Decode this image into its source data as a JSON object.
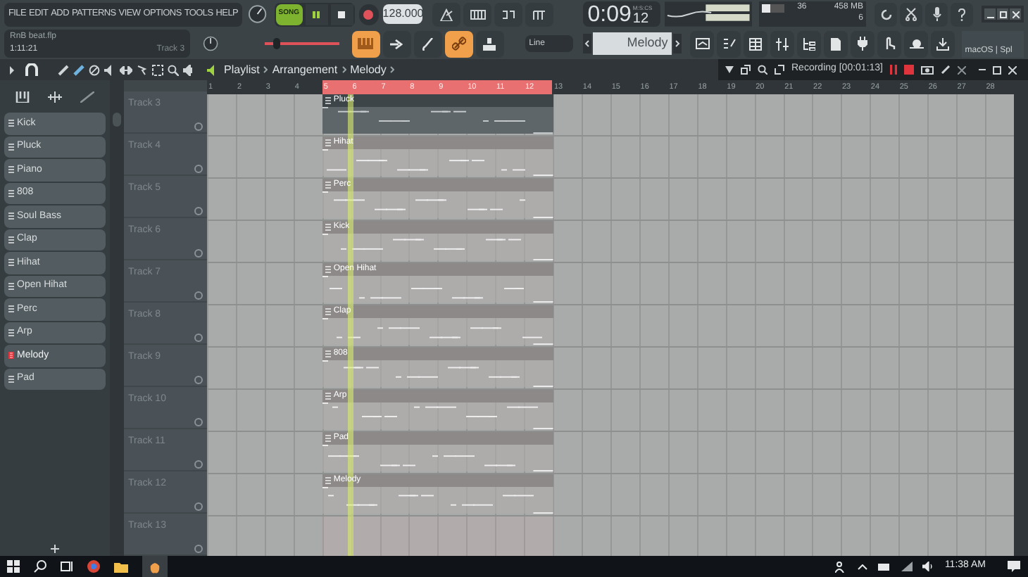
{
  "menu": [
    "FILE",
    "EDIT",
    "ADD",
    "PATTERNS",
    "VIEW",
    "OPTIONS",
    "TOOLS",
    "HELP"
  ],
  "song_info": {
    "file": "RnB beat.flp",
    "position": "1:11:21",
    "hint": "Track 3"
  },
  "transport": {
    "mode": "SONG",
    "song_mode": true,
    "recording": false,
    "tempo": "128.000"
  },
  "time": {
    "display": "0:09",
    "centiseconds": "12",
    "unit": "M:S:CS"
  },
  "cpu": {
    "value": "36",
    "memory": "458 MB",
    "polyphony": "6",
    "level": 0.4
  },
  "snap": "Line",
  "pattern": "Melody",
  "project_label": "macOS | Spl",
  "breadcrumb": [
    "Playlist",
    "Arrangement",
    "Melody"
  ],
  "recording_label": "Recording [00:01:13]",
  "channels": [
    {
      "name": "Kick",
      "selected": false
    },
    {
      "name": "Pluck",
      "selected": false
    },
    {
      "name": "Piano",
      "selected": false
    },
    {
      "name": "808",
      "selected": false
    },
    {
      "name": "Soul Bass",
      "selected": false
    },
    {
      "name": "Clap",
      "selected": false
    },
    {
      "name": "Hihat",
      "selected": false
    },
    {
      "name": "Open Hihat",
      "selected": false
    },
    {
      "name": "Perc",
      "selected": false
    },
    {
      "name": "Arp",
      "selected": false
    },
    {
      "name": "Melody",
      "selected": true
    },
    {
      "name": "Pad",
      "selected": false
    }
  ],
  "pitch_slider": {
    "level": 0.1
  },
  "ruler": [
    {
      "label": "1",
      "selected": false
    },
    {
      "label": "2",
      "selected": false
    },
    {
      "label": "3",
      "selected": false
    },
    {
      "label": "4",
      "selected": false
    },
    {
      "label": "5",
      "selected": true
    },
    {
      "label": "6",
      "selected": true
    },
    {
      "label": "7",
      "selected": true
    },
    {
      "label": "8",
      "selected": true
    },
    {
      "label": "9",
      "selected": true
    },
    {
      "label": "10",
      "selected": true
    },
    {
      "label": "11",
      "selected": true
    },
    {
      "label": "12",
      "selected": true
    },
    {
      "label": "13",
      "selected": false
    },
    {
      "label": "14",
      "selected": false
    },
    {
      "label": "15",
      "selected": false
    },
    {
      "label": "16",
      "selected": false
    },
    {
      "label": "17",
      "selected": false
    },
    {
      "label": "18",
      "selected": false
    },
    {
      "label": "19",
      "selected": false
    },
    {
      "label": "20",
      "selected": false
    },
    {
      "label": "21",
      "selected": false
    },
    {
      "label": "22",
      "selected": false
    },
    {
      "label": "23",
      "selected": false
    },
    {
      "label": "24",
      "selected": false
    },
    {
      "label": "25",
      "selected": false
    },
    {
      "label": "26",
      "selected": false
    },
    {
      "label": "27",
      "selected": false
    },
    {
      "label": "28",
      "selected": false
    }
  ],
  "playhead": {
    "level": 0.175
  },
  "tracks": [
    {
      "name": "Track 3",
      "clip": {
        "name": "Pluck",
        "selected": true
      }
    },
    {
      "name": "Track 4",
      "clip": {
        "name": "Hihat",
        "selected": false
      }
    },
    {
      "name": "Track 5",
      "clip": {
        "name": "Perc",
        "selected": false
      }
    },
    {
      "name": "Track 6",
      "clip": {
        "name": "Kick",
        "selected": false
      }
    },
    {
      "name": "Track 7",
      "clip": {
        "name": "Open Hihat",
        "selected": false
      }
    },
    {
      "name": "Track 8",
      "clip": {
        "name": "Clap",
        "selected": false
      }
    },
    {
      "name": "Track 9",
      "clip": {
        "name": "808",
        "selected": false
      }
    },
    {
      "name": "Track 10",
      "clip": {
        "name": "Arp",
        "selected": false
      }
    },
    {
      "name": "Track 11",
      "clip": {
        "name": "Pad",
        "selected": false
      }
    },
    {
      "name": "Track 12",
      "clip": {
        "name": "Melody",
        "selected": false
      }
    },
    {
      "name": "Track 13"
    }
  ],
  "taskbar": {
    "clock": "11:38 AM"
  }
}
